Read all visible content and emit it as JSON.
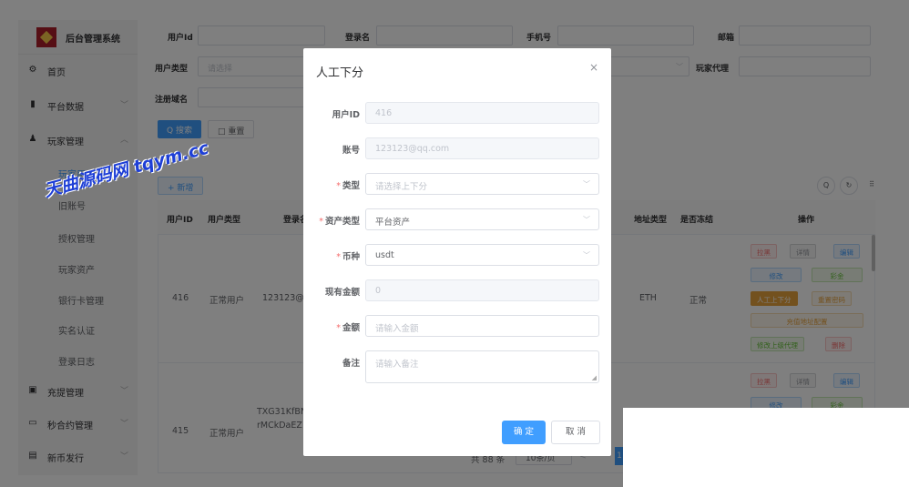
{
  "sidebar": {
    "brand": "后台管理系统",
    "items": [
      {
        "label": "首页"
      },
      {
        "label": "平台数据"
      },
      {
        "label": "玩家管理"
      }
    ],
    "sub_items": [
      {
        "label": "玩家用户"
      },
      {
        "label": "旧账号"
      },
      {
        "label": "授权管理"
      },
      {
        "label": "玩家资产"
      },
      {
        "label": "银行卡管理"
      },
      {
        "label": "实名认证"
      },
      {
        "label": "登录日志"
      }
    ],
    "bottom_items": [
      {
        "label": "充提管理"
      },
      {
        "label": "秒合约管理"
      },
      {
        "label": "新币发行"
      }
    ]
  },
  "filters": {
    "user_id": "用户Id",
    "login_name": "登录名",
    "phone": "手机号",
    "email": "邮箱",
    "user_type": "用户类型",
    "user_type_placeholder": "请选择",
    "agent": "玩家代理",
    "domain": "注册域名",
    "search_btn": "Q 搜索",
    "reset_btn": "□ 重置",
    "add_btn": "+ 新增"
  },
  "table": {
    "headers": [
      "用户ID",
      "用户类型",
      "登录名",
      "地址类型",
      "是否冻结",
      "操作"
    ],
    "rows": [
      {
        "id": "416",
        "type": "正常用户",
        "login": "123123@q",
        "addr_type": "ETH",
        "frozen": "正常"
      },
      {
        "id": "415",
        "type": "正常用户",
        "login": "TXG31KfBNt",
        "login2": "rMCkDaEZ"
      }
    ],
    "actions": [
      "拉黑",
      "详情",
      "编辑",
      "修改",
      "彩金",
      "人工上下分",
      "重置密码",
      "充值地址配置",
      "修改上级代理",
      "删除"
    ],
    "pagination": {
      "total": "共 88 条",
      "page_size": "10条/页",
      "current": "1"
    }
  },
  "dialog": {
    "title": "人工下分",
    "close": "×",
    "fields": {
      "user_id": {
        "label": "用户ID",
        "value": "416"
      },
      "account": {
        "label": "账号",
        "value": "123123@qq.com"
      },
      "type": {
        "label": "类型",
        "placeholder": "请选择上下分"
      },
      "asset_type": {
        "label": "资产类型",
        "value": "平台资产"
      },
      "coin": {
        "label": "币种",
        "value": "usdt"
      },
      "balance": {
        "label": "现有金额",
        "value": "0"
      },
      "amount": {
        "label": "金额",
        "placeholder": "请输入金额"
      },
      "remark": {
        "label": "备注",
        "placeholder": "请输入备注"
      }
    },
    "confirm": "确 定",
    "cancel": "取 消"
  },
  "watermark": "天曲源码网 tqym.cc"
}
